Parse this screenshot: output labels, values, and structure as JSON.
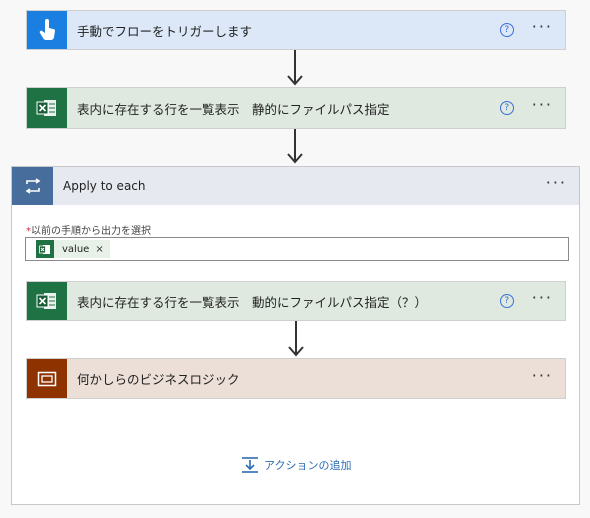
{
  "trigger": {
    "title": "手動でフローをトリガーします",
    "help": "?",
    "more": "···",
    "color": "#1a7fe0",
    "bg": "#dce8f8"
  },
  "list_static": {
    "title": "表内に存在する行を一覧表示　静的にファイルパス指定",
    "help": "?",
    "more": "···",
    "color": "#1f7244",
    "bg": "#dfe9e0"
  },
  "apply_each": {
    "title": "Apply to each",
    "more": "···",
    "field_label_required": "*",
    "field_label": "以前の手順から出力を選択",
    "token_label": "value",
    "token_remove": "×",
    "list_dynamic": {
      "title": "表内に存在する行を一覧表示　動的にファイルパス指定（？）",
      "help": "?",
      "more": "···"
    },
    "business": {
      "title": "何かしらのビジネスロジック",
      "more": "···",
      "color": "#8e3200",
      "bg": "#ecdfd7"
    },
    "add_action": "アクションの追加"
  },
  "icons": [
    "touch-trigger-icon",
    "excel-icon",
    "loop-icon",
    "scope-icon",
    "add-action-icon",
    "help-icon",
    "more-icon"
  ]
}
